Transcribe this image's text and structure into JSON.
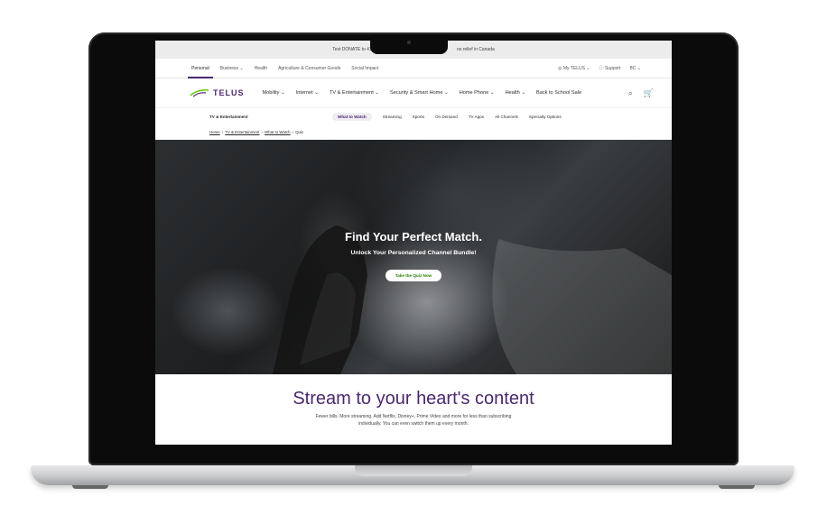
{
  "announce": {
    "left": "Text DONATE to 41010",
    "right": "ns relief in Canada"
  },
  "topnav": {
    "items": [
      "Personal",
      "Business ⌄",
      "Health",
      "Agriculture & Consumer Goods",
      "Social Impact"
    ],
    "right": [
      "My TELUS ⌄",
      "Support",
      "BC ⌄"
    ]
  },
  "mainnav": {
    "brand": "TELUS",
    "items": [
      "Mobility ⌄",
      "Internet ⌄",
      "TV & Entertainment ⌄",
      "Security & Smart Home ⌄",
      "Home Phone ⌄",
      "Health ⌄",
      "Back to School Sale"
    ]
  },
  "subnav": {
    "section": "TV & Entertainment",
    "items": [
      "What to Watch",
      "Streaming",
      "Sports",
      "On Demand",
      "TV Apps",
      "All Channels",
      "Specialty Options"
    ]
  },
  "breadcrumb": [
    "Home",
    "TV & Entertainment",
    "What to Watch",
    "Quiz"
  ],
  "hero": {
    "title": "Find Your Perfect Match.",
    "subtitle": "Unlock Your Personalized Channel Bundle!",
    "cta": "Take the Quiz Now"
  },
  "stream": {
    "title": "Stream to your heart's content",
    "line1": "Fewer bills. More streaming. Add Netflix, Disney+, Prime Video and more for less than subscribing",
    "line2": "individually. You can even switch them up every month."
  },
  "colors": {
    "brand": "#4b286d",
    "accent": "#2b8000"
  }
}
